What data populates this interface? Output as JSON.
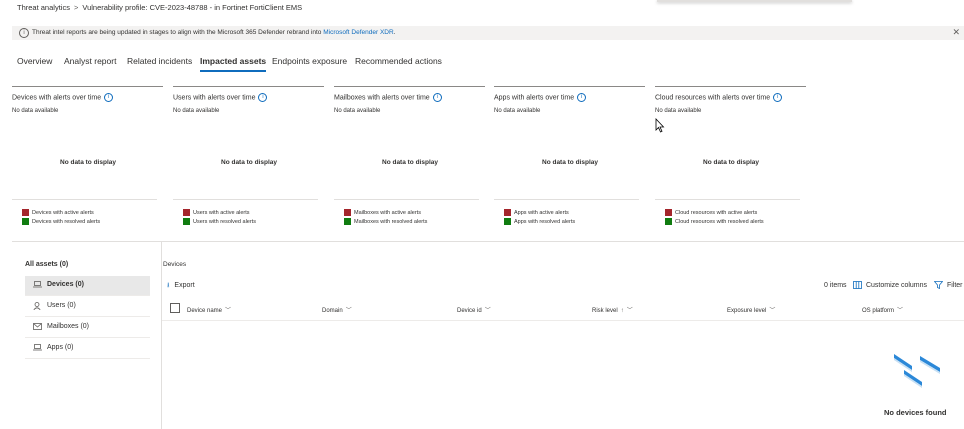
{
  "breadcrumb": {
    "root": "Threat analytics",
    "separator": ">",
    "current": "Vulnerability profile: CVE-2023-48788 - in Fortinet FortiClient EMS"
  },
  "banner": {
    "message": "Threat intel reports are being updated in stages to align with the Microsoft 365 Defender rebrand into ",
    "link": "Microsoft Defender XDR",
    "suffix": ".",
    "close_icon": "close-icon"
  },
  "tabs": [
    {
      "label": "Overview",
      "active": false
    },
    {
      "label": "Analyst report",
      "active": false
    },
    {
      "label": "Related incidents",
      "active": false
    },
    {
      "label": "Impacted assets",
      "active": true
    },
    {
      "label": "Endpoints exposure",
      "active": false
    },
    {
      "label": "Recommended actions",
      "active": false
    }
  ],
  "cards": [
    {
      "title": "Devices with alerts over time",
      "no_data_available": "No data available",
      "no_data_display": "No data to display",
      "legend_active": "Devices with active alerts",
      "legend_resolved": "Devices with resolved alerts"
    },
    {
      "title": "Users with alerts over time",
      "no_data_available": "No data available",
      "no_data_display": "No data to display",
      "legend_active": "Users with active alerts",
      "legend_resolved": "Users with resolved alerts"
    },
    {
      "title": "Mailboxes with alerts over time",
      "no_data_available": "No data available",
      "no_data_display": "No data to display",
      "legend_active": "Mailboxes with active alerts",
      "legend_resolved": "Mailboxes with resolved alerts"
    },
    {
      "title": "Apps with alerts over time",
      "no_data_available": "No data available",
      "no_data_display": "No data to display",
      "legend_active": "Apps with active alerts",
      "legend_resolved": "Apps with resolved alerts"
    },
    {
      "title": "Cloud resources with alerts over time",
      "no_data_available": "No data available",
      "no_data_display": "No data to display",
      "legend_active": "Cloud resources with active alerts",
      "legend_resolved": "Cloud resources with resolved alerts"
    }
  ],
  "colors": {
    "active": "#a4262c",
    "resolved": "#107c10",
    "accent": "#0f6cbd"
  },
  "assets": {
    "header": "All assets (0)",
    "items": [
      {
        "label": "Devices (0)",
        "icon": "laptop-icon",
        "selected": true
      },
      {
        "label": "Users (0)",
        "icon": "person-icon",
        "selected": false
      },
      {
        "label": "Mailboxes (0)",
        "icon": "mail-icon",
        "selected": false
      },
      {
        "label": "Apps (0)",
        "icon": "app-icon",
        "selected": false
      }
    ]
  },
  "devices": {
    "section_label": "Devices",
    "export_label": "Export",
    "items_count": "0 items",
    "customize_label": "Customize columns",
    "filter_label": "Filter",
    "columns": [
      {
        "label": "Device name",
        "sort": ""
      },
      {
        "label": "Domain",
        "sort": ""
      },
      {
        "label": "Device id",
        "sort": ""
      },
      {
        "label": "Risk level",
        "sort": "↑"
      },
      {
        "label": "Exposure level",
        "sort": ""
      },
      {
        "label": "OS platform",
        "sort": ""
      }
    ],
    "empty_message": "No devices found"
  }
}
